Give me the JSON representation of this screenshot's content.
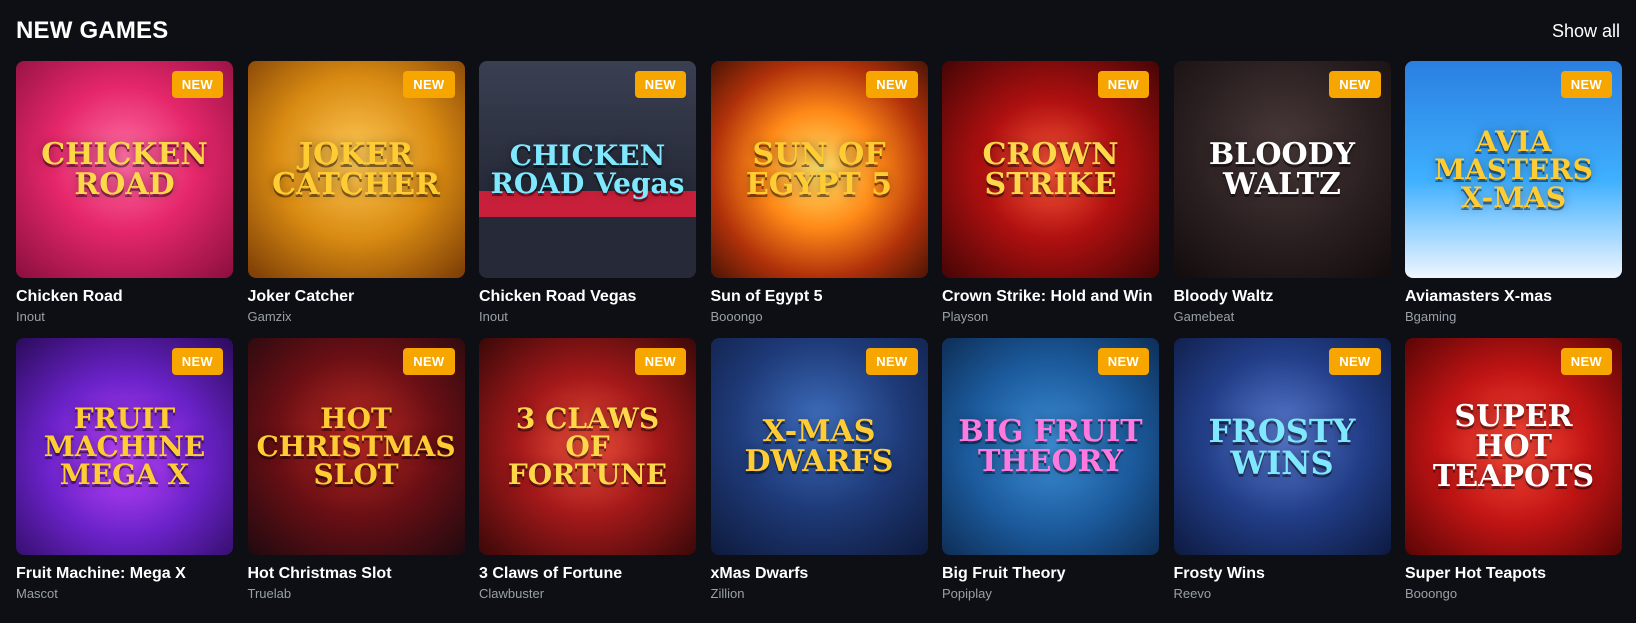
{
  "section": {
    "title": "NEW GAMES",
    "show_all": "Show all"
  },
  "badge_label": "NEW",
  "games": [
    {
      "name": "Chicken Road",
      "provider": "Inout",
      "art": "CHICKEN ROAD"
    },
    {
      "name": "Joker Catcher",
      "provider": "Gamzix",
      "art": "JOKER CATCHER"
    },
    {
      "name": "Chicken Road Vegas",
      "provider": "Inout",
      "art": "CHICKEN ROAD Vegas"
    },
    {
      "name": "Sun of Egypt 5",
      "provider": "Booongo",
      "art": "SUN OF EGYPT 5"
    },
    {
      "name": "Crown Strike: Hold and Win",
      "provider": "Playson",
      "art": "CROWN STRIKE"
    },
    {
      "name": "Bloody Waltz",
      "provider": "Gamebeat",
      "art": "BLOODY WALTZ"
    },
    {
      "name": "Aviamasters X-mas",
      "provider": "Bgaming",
      "art": "AVIA MASTERS X-MAS"
    },
    {
      "name": "Fruit Machine: Mega X",
      "provider": "Mascot",
      "art": "FRUIT MACHINE MEGA X"
    },
    {
      "name": "Hot Christmas Slot",
      "provider": "Truelab",
      "art": "HOT CHRISTMAS SLOT"
    },
    {
      "name": "3 Claws of Fortune",
      "provider": "Clawbuster",
      "art": "3 CLAWS OF FORTUNE"
    },
    {
      "name": "xMas Dwarfs",
      "provider": "Zillion",
      "art": "X-MAS DWARFS"
    },
    {
      "name": "Big Fruit Theory",
      "provider": "Popiplay",
      "art": "BIG FRUIT THEORY"
    },
    {
      "name": "Frosty Wins",
      "provider": "Reevo",
      "art": "FROSTY WINS"
    },
    {
      "name": "Super Hot Teapots",
      "provider": "Booongo",
      "art": "SUPER HOT TEAPOTS"
    }
  ]
}
